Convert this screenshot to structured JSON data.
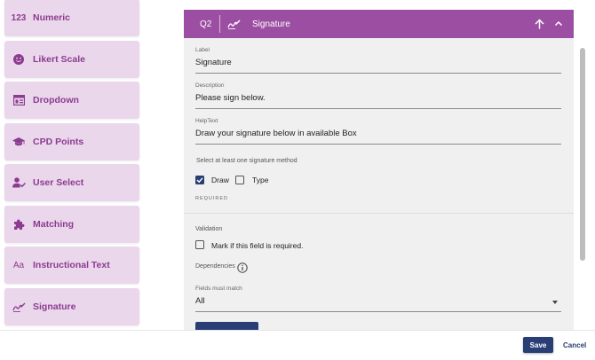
{
  "sidebar": {
    "items": [
      {
        "label": "Numeric",
        "icon": "numeric-123-icon"
      },
      {
        "label": "Likert Scale",
        "icon": "smiley-icon"
      },
      {
        "label": "Dropdown",
        "icon": "dropdown-list-icon"
      },
      {
        "label": "CPD Points",
        "icon": "graduation-cap-icon"
      },
      {
        "label": "User Select",
        "icon": "user-check-icon"
      },
      {
        "label": "Matching",
        "icon": "puzzle-icon"
      },
      {
        "label": "Instructional Text",
        "icon": "text-aa-icon"
      },
      {
        "label": "Signature",
        "icon": "signature-icon"
      }
    ],
    "numeric_glyph": "123",
    "text_glyph": "Aa"
  },
  "question": {
    "number": "Q2",
    "title": "Signature",
    "label_caption": "Label",
    "label_value": "Signature",
    "description_caption": "Description",
    "description_value": "Please sign below.",
    "helptext_caption": "HelpText",
    "helptext_value": "Draw your signature below in available Box",
    "method_instruction": "Select at least one signature method",
    "methods": [
      {
        "label": "Draw",
        "checked": true
      },
      {
        "label": "Type",
        "checked": false
      }
    ],
    "required_tag": "REQUIRED",
    "validation_caption": "Validation",
    "required_checkbox_label": "Mark if this field is required.",
    "dependencies_caption": "Dependencies",
    "fields_must_match_caption": "Fields must match",
    "fields_must_match_value": "All"
  },
  "footer": {
    "save_label": "Save",
    "cancel_label": "Cancel"
  },
  "colors": {
    "accent": "#9c4ea3",
    "sidebar_item_bg": "#ead7eb",
    "sidebar_text": "#8c3b91",
    "primary_button": "#283e74"
  }
}
